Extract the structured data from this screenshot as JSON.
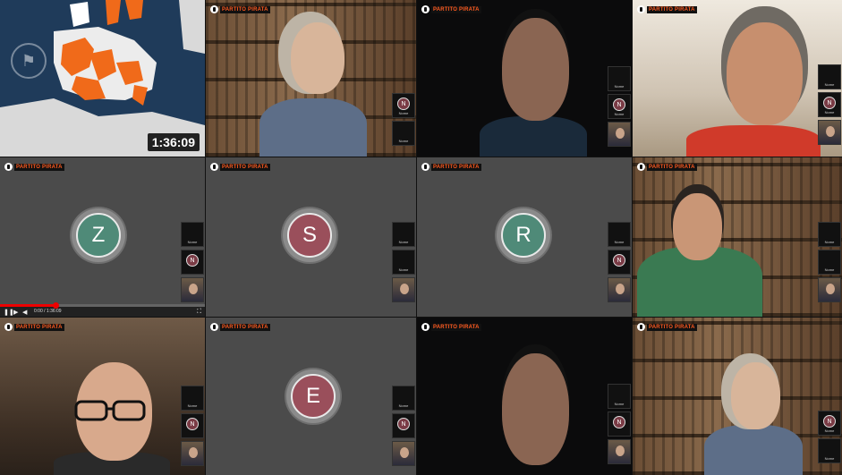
{
  "brand": {
    "logo_text": "PARTITO PIRATA"
  },
  "map_tile": {
    "timestamp": "1:36:09"
  },
  "player": {
    "timecode": "0:00 / 1:36:09",
    "progress": 0.27
  },
  "avatars": [
    {
      "letter": "Z",
      "color": "#4f8a78"
    },
    {
      "letter": "S",
      "color": "#9a4f5b"
    },
    {
      "letter": "R",
      "color": "#4f8a78"
    },
    {
      "letter": "E",
      "color": "#9a4f5b"
    }
  ],
  "side_letters": [
    "N",
    "N",
    "N",
    "N",
    "N"
  ],
  "side_caption": "Nome",
  "icons": [
    "pirate-party-logo",
    "play-icon",
    "next-icon",
    "volume-icon",
    "fullscreen-icon"
  ]
}
